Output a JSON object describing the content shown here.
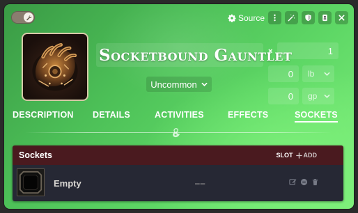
{
  "header": {
    "source_label": "Source",
    "toggle_state": "on"
  },
  "item": {
    "name": "Socketbound Gauntlet",
    "rarity": "Uncommon",
    "quantity_symbol": "×",
    "quantity": "1",
    "weight_value": "0",
    "weight_unit": "lb",
    "price_value": "0",
    "price_unit": "gp"
  },
  "tabs": [
    {
      "label": "DESCRIPTION",
      "active": false
    },
    {
      "label": "DETAILS",
      "active": false
    },
    {
      "label": "ACTIVITIES",
      "active": false
    },
    {
      "label": "EFFECTS",
      "active": false
    },
    {
      "label": "SOCKETS",
      "active": true
    }
  ],
  "sockets_panel": {
    "title": "Sockets",
    "slot_label": "SLOT",
    "add_label": "ADD",
    "rows": [
      {
        "name": "Empty",
        "value": "––"
      }
    ]
  },
  "colors": {
    "sheet_green": "#4cbf57",
    "panel_header": "#4a1a1f",
    "panel_row": "#262834"
  }
}
